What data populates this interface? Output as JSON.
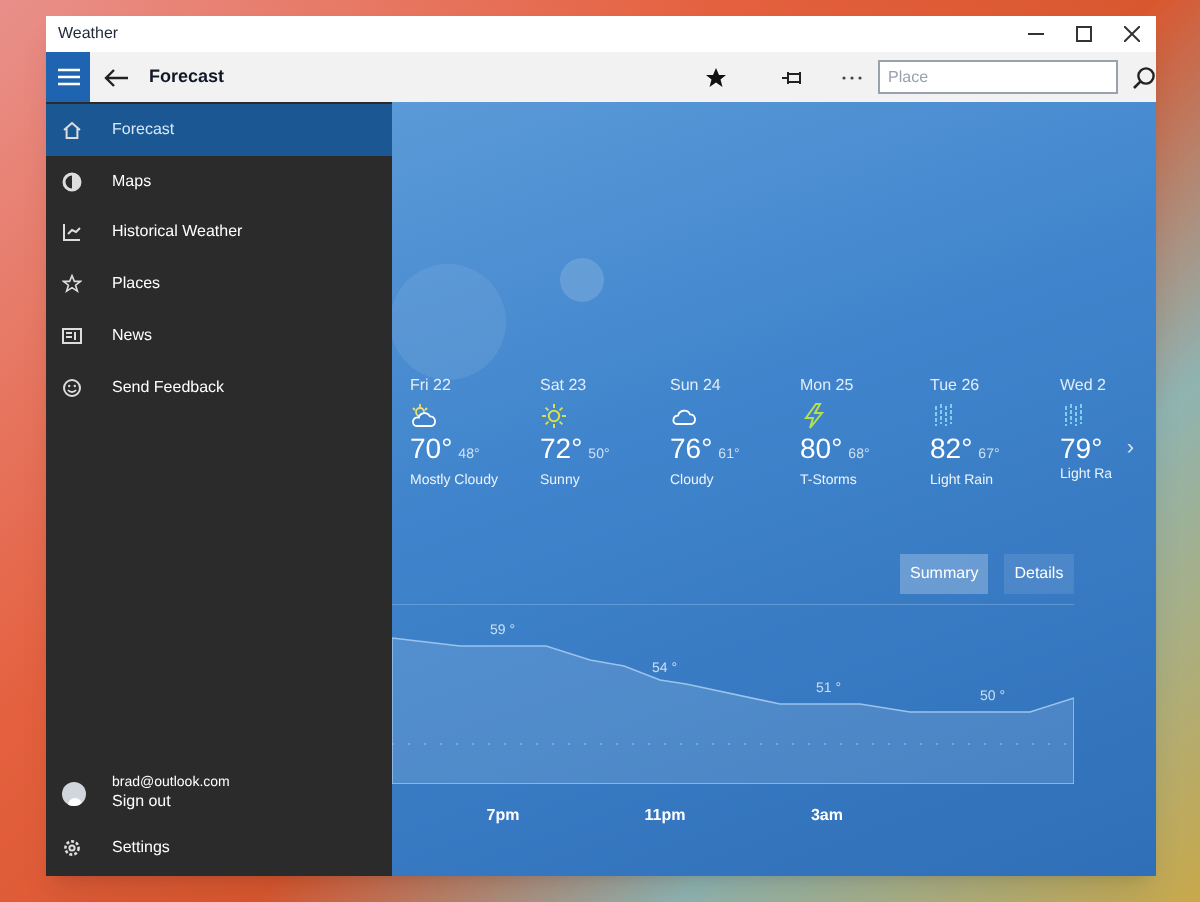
{
  "window": {
    "title": "Weather"
  },
  "toolbar": {
    "title": "Forecast",
    "search": {
      "placeholder": "Place"
    }
  },
  "sidebar": {
    "items": [
      {
        "label": "Forecast",
        "kind": "home",
        "selected": true
      },
      {
        "label": "Maps",
        "kind": "maps",
        "selected": false
      },
      {
        "label": "Historical Weather",
        "kind": "history",
        "selected": false
      },
      {
        "label": "Places",
        "kind": "star",
        "selected": false
      },
      {
        "label": "News",
        "kind": "news",
        "selected": false
      },
      {
        "label": "Send Feedback",
        "kind": "feedback",
        "selected": false
      }
    ],
    "account": {
      "email": "brad@outlook.com",
      "action": "Sign out"
    },
    "settings": "Settings"
  },
  "days": [
    {
      "date": "Fri 22",
      "kind": "partly-cloudy",
      "high": "70°",
      "low": "48°",
      "condition": "Mostly Cloudy"
    },
    {
      "date": "Sat 23",
      "kind": "sunny",
      "high": "72°",
      "low": "50°",
      "condition": "Sunny"
    },
    {
      "date": "Sun 24",
      "kind": "cloudy",
      "high": "76°",
      "low": "61°",
      "condition": "Cloudy"
    },
    {
      "date": "Mon 25",
      "kind": "storm",
      "high": "80°",
      "low": "68°",
      "condition": "T-Storms"
    },
    {
      "date": "Tue 26",
      "kind": "rain",
      "high": "82°",
      "low": "67°",
      "condition": "Light Rain"
    },
    {
      "date": "Wed 2",
      "kind": "rain",
      "high": "79°",
      "condition": "Light Ra"
    }
  ],
  "next": "›",
  "views": [
    {
      "label": "Summary",
      "selected": true
    },
    {
      "label": "Details",
      "selected": false
    }
  ],
  "hourly": {
    "temperatures": [
      "59 °",
      "54 °",
      "51 °",
      "50 °"
    ],
    "times": [
      "7pm",
      "11pm",
      "3am"
    ]
  }
}
